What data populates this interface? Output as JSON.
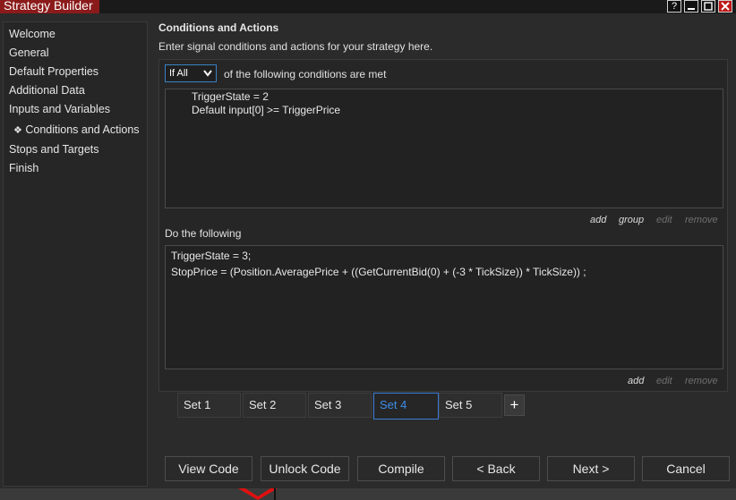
{
  "window": {
    "title": "Strategy Builder",
    "controls": [
      {
        "name": "help-icon",
        "glyph": "?"
      },
      {
        "name": "minimize-icon",
        "glyph": ""
      },
      {
        "name": "maximize-icon",
        "glyph": ""
      },
      {
        "name": "close-icon",
        "glyph": ""
      }
    ],
    "accent_color": "#8b1a1a"
  },
  "sidebar": {
    "items": [
      {
        "label": "Welcome",
        "active": false
      },
      {
        "label": "General",
        "active": false
      },
      {
        "label": "Default Properties",
        "active": false
      },
      {
        "label": "Additional Data",
        "active": false
      },
      {
        "label": "Inputs and Variables",
        "active": false
      },
      {
        "label": "Conditions and Actions",
        "active": true,
        "marker": "❖"
      },
      {
        "label": "Stops and Targets",
        "active": false
      },
      {
        "label": "Finish",
        "active": false
      }
    ]
  },
  "main": {
    "heading": "Conditions and Actions",
    "description": "Enter signal conditions and actions for your strategy here.",
    "conditions": {
      "logic_select": {
        "value": "If All",
        "options": [
          "If All"
        ]
      },
      "logic_suffix": "of the following conditions are met",
      "lines": [
        "TriggerState = 2",
        "Default input[0] >= TriggerPrice"
      ],
      "actions": {
        "add": "add",
        "group": "group",
        "edit": "edit",
        "remove": "remove"
      }
    },
    "actions_section": {
      "label": "Do the following",
      "lines": [
        "TriggerState = 3;",
        "StopPrice = (Position.AveragePrice + ((GetCurrentBid(0) + (-3 * TickSize))  * TickSize)) ;"
      ],
      "actions": {
        "add": "add",
        "edit": "edit",
        "remove": "remove"
      }
    },
    "sets": {
      "tabs": [
        {
          "label": "Set 1",
          "active": false
        },
        {
          "label": "Set 2",
          "active": false
        },
        {
          "label": "Set 3",
          "active": false
        },
        {
          "label": "Set 4",
          "active": true
        },
        {
          "label": "Set 5",
          "active": false
        }
      ],
      "add_label": "+"
    }
  },
  "footer": {
    "buttons": {
      "view_code": "View Code",
      "unlock_code": "Unlock Code",
      "compile": "Compile",
      "back": "< Back",
      "next": "Next >",
      "cancel": "Cancel"
    }
  }
}
